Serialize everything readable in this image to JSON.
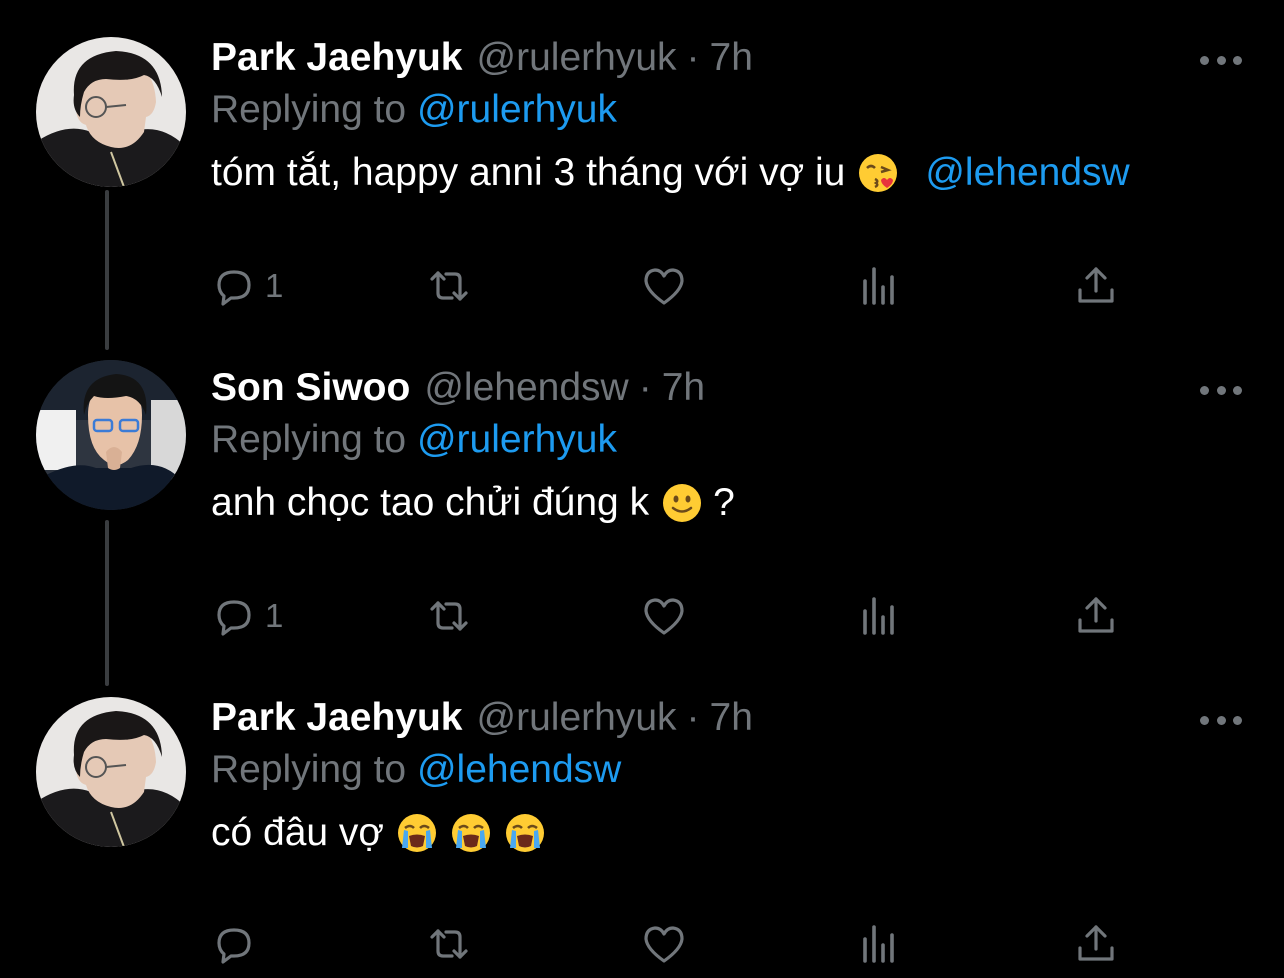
{
  "tweets": [
    {
      "name": "Park Jaehyuk",
      "handle": "@rulerhyuk",
      "separator": "·",
      "time": "7h",
      "replying_prefix": "Replying to",
      "replying_to": "@rulerhyuk",
      "text": "tóm tắt, happy anni 3 tháng với vợ iu",
      "emojis": [
        "kissing-heart-emoji"
      ],
      "trailing_mention": "@lehendsw",
      "reply_count": "1"
    },
    {
      "name": "Son Siwoo",
      "handle": "@lehendsw",
      "separator": "·",
      "time": "7h",
      "replying_prefix": "Replying to",
      "replying_to": "@rulerhyuk",
      "text": "anh chọc tao chửi đúng k",
      "emojis": [
        "slightly-smiling-emoji"
      ],
      "text_suffix": "?",
      "reply_count": "1"
    },
    {
      "name": "Park Jaehyuk",
      "handle": "@rulerhyuk",
      "separator": "·",
      "time": "7h",
      "replying_prefix": "Replying to",
      "replying_to": "@lehendsw",
      "text": "có đâu vợ",
      "emojis": [
        "crying-emoji",
        "crying-emoji",
        "crying-emoji"
      ],
      "reply_count": ""
    }
  ],
  "colors": {
    "background": "#000000",
    "name": "#ffffff",
    "muted": "#71767b",
    "link": "#1d9bf0",
    "thread_line": "#3a3d40"
  },
  "icons": [
    "reply-icon",
    "retweet-icon",
    "like-icon",
    "analytics-icon",
    "share-icon",
    "more-icon"
  ]
}
